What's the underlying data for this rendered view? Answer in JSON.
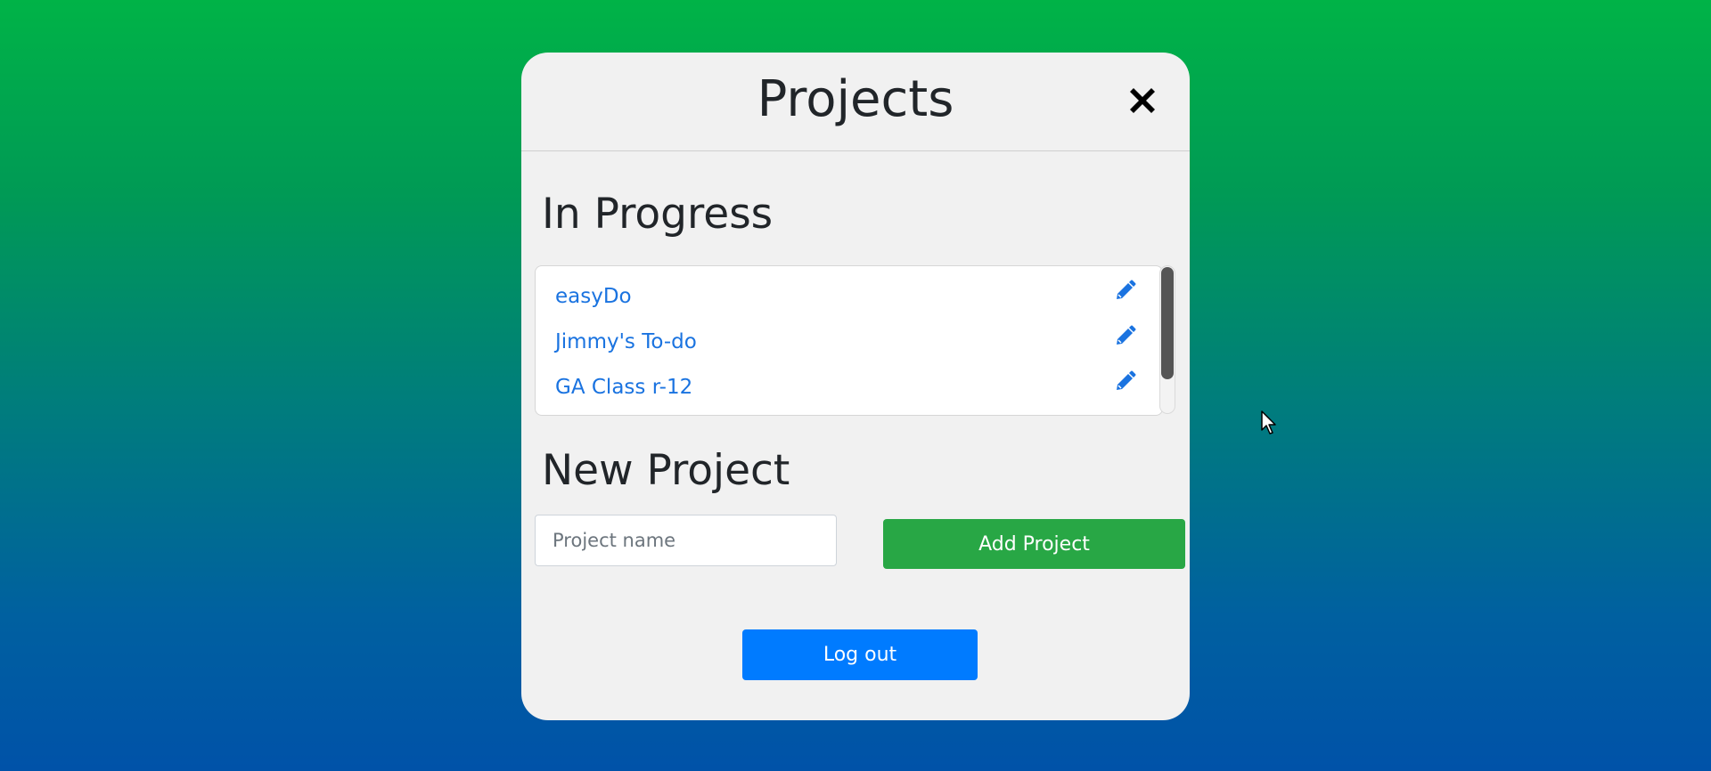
{
  "modal": {
    "title": "Projects",
    "close_icon": "close-icon"
  },
  "in_progress": {
    "heading": "In Progress",
    "projects": [
      {
        "name": "easyDo",
        "edit_icon": "pencil-icon"
      },
      {
        "name": "Jimmy's To-do",
        "edit_icon": "pencil-icon"
      },
      {
        "name": "GA Class r-12",
        "edit_icon": "pencil-icon"
      }
    ]
  },
  "new_project": {
    "heading": "New Project",
    "input_placeholder": "Project name",
    "input_value": "",
    "add_button_label": "Add Project"
  },
  "logout_label": "Log out",
  "colors": {
    "add_button": "#28a745",
    "logout_button": "#007bff",
    "link": "#1a73e0",
    "modal_bg": "#f1f1f1"
  }
}
